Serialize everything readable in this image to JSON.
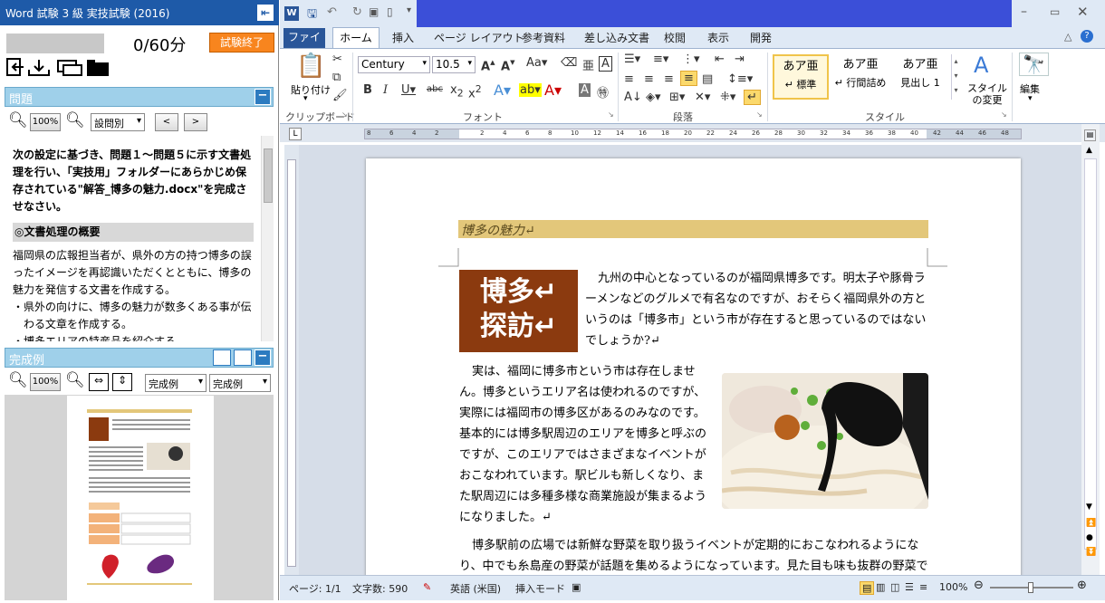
{
  "exam": {
    "title": "Word 試験 3 級 実技試験 (2016)",
    "timer": "0/60分",
    "finish_label": "試験終了",
    "problem_header": "問題",
    "zoom_label": "100%",
    "question_select": "設問別",
    "prev": "<",
    "next": ">",
    "problem_lead": "次の設定に基づき、問題１～問題５に示す文書処理を行い、「実技用」フォルダーにあらかじめ保存されている\"解答_博多の魅力.docx\"を完成させなさい。",
    "section_title": "◎文書処理の概要",
    "section_text": "福岡県の広報担当者が、県外の方の持つ博多の誤ったイメージを再認識いただくとともに、博多の魅力を発信する文書を作成する。",
    "bullet1": "・県外の向けに、博多の魅力が数多くある事が伝わる文章を作成する。",
    "bullet2": "・博多エリアの特産品を紹介する",
    "sample_header": "完成例",
    "sample_zoom": "100%",
    "sample_select1": "完成例",
    "sample_select2": "完成例"
  },
  "word": {
    "tabs": [
      "ファイル",
      "ホーム",
      "挿入",
      "ページ レイアウト",
      "参考資料",
      "差し込み文書",
      "校閲",
      "表示",
      "開発"
    ],
    "font_name": "Century",
    "font_size": "10.5",
    "paste_label": "貼り付け",
    "groups": {
      "clipboard": "クリップボード",
      "font": "フォント",
      "paragraph": "段落",
      "styles": "スタイル"
    },
    "styles": [
      {
        "sample": "あア亜",
        "name": "↵ 標準"
      },
      {
        "sample": "あア亜",
        "name": "↵ 行間詰め"
      },
      {
        "sample": "あア亜",
        "name": "見出し 1"
      }
    ],
    "change_styles": "スタイルの変更",
    "edit_label": "編集",
    "ruler_ticks": [
      "8",
      "6",
      "4",
      "2",
      "",
      "2",
      "4",
      "6",
      "8",
      "10",
      "12",
      "14",
      "16",
      "18",
      "20",
      "22",
      "24",
      "26",
      "28",
      "30",
      "32",
      "34",
      "36",
      "38",
      "40",
      "42",
      "44",
      "46",
      "48"
    ]
  },
  "document": {
    "heading": "博多の魅力↵",
    "box_line1": "博多↵",
    "box_line2": "探訪↵",
    "para1": "九州の中心となっているのが福岡県博多です。明太子や豚骨ラーメンなどのグルメで有名なのですが、おそらく福岡県外の方というのは「博多市」という市が存在すると思っているのではないでしょうか?↵",
    "para2": "実は、福岡に博多市という市は存在しません。博多というエリア名は使われるのですが、実際には福岡市の博多区があるのみなのです。基本的には博多駅周辺のエリアを博多と呼ぶのですが、このエリアではさまざまなイベントがおこなわれています。駅ビルも新しくなり、また駅周辺には多種多様な商業施設が集まるようになりました。↵",
    "para3": "博多駅前の広場では新鮮な野菜を取り扱うイベントが定期的におこなわれるようになり、中でも糸島産の野菜が話題を集めるようになっています。見た目も味も抜群の野菜ですの"
  },
  "status": {
    "page": "ページ: 1/1",
    "words": "文字数: 590",
    "language": "英語 (米国)",
    "mode": "挿入モード",
    "zoom": "100%"
  },
  "colors": {
    "accent": "#2a5699",
    "finish": "#f8851e",
    "heading_band": "#e3c77a",
    "box": "#8b3a0f"
  }
}
